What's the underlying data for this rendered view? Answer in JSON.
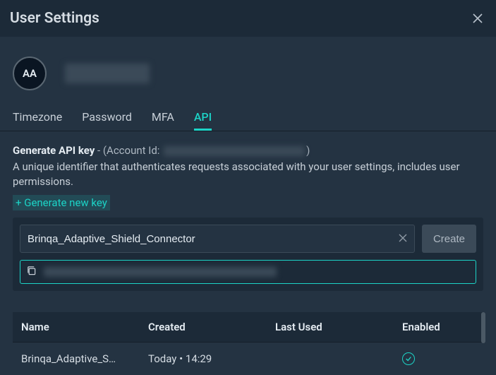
{
  "header": {
    "title": "User Settings"
  },
  "profile": {
    "avatar_initials": "AA"
  },
  "tabs": [
    {
      "id": "timezone",
      "label": "Timezone",
      "active": false
    },
    {
      "id": "password",
      "label": "Password",
      "active": false
    },
    {
      "id": "mfa",
      "label": "MFA",
      "active": false
    },
    {
      "id": "api",
      "label": "API",
      "active": true
    }
  ],
  "api_section": {
    "title_strong": "Generate API key",
    "title_rest_prefix": " - (Account Id: ",
    "title_rest_suffix": ")",
    "description": "A unique identifier that authenticates requests associated with your user settings, includes user permissions.",
    "generate_link": "+ Generate new key",
    "name_input_value": "Brinqa_Adaptive_Shield_Connector",
    "create_button": "Create"
  },
  "table": {
    "columns": {
      "name": "Name",
      "created": "Created",
      "last_used": "Last Used",
      "enabled": "Enabled"
    },
    "rows": [
      {
        "name": "Brinqa_Adaptive_S…",
        "created": "Today • 14:29",
        "last_used": "",
        "enabled": true
      }
    ]
  }
}
